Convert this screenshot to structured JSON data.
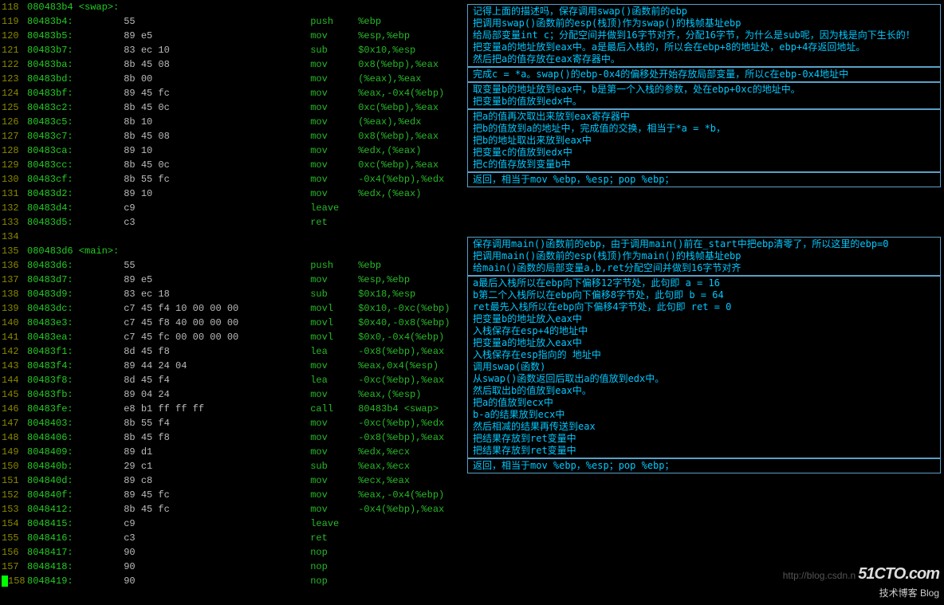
{
  "code_rows": [
    {
      "ln": "118",
      "head": "080483b4 <swap>:"
    },
    {
      "ln": "119",
      "addr": "80483b4:",
      "hex": "55",
      "op": "push",
      "arg": "%ebp"
    },
    {
      "ln": "120",
      "addr": "80483b5:",
      "hex": "89 e5",
      "op": "mov",
      "arg": "%esp,%ebp"
    },
    {
      "ln": "121",
      "addr": "80483b7:",
      "hex": "83 ec 10",
      "op": "sub",
      "arg": "$0x10,%esp"
    },
    {
      "ln": "122",
      "addr": "80483ba:",
      "hex": "8b 45 08",
      "op": "mov",
      "arg": "0x8(%ebp),%eax"
    },
    {
      "ln": "123",
      "addr": "80483bd:",
      "hex": "8b 00",
      "op": "mov",
      "arg": "(%eax),%eax"
    },
    {
      "ln": "124",
      "addr": "80483bf:",
      "hex": "89 45 fc",
      "op": "mov",
      "arg": "%eax,-0x4(%ebp)"
    },
    {
      "ln": "125",
      "addr": "80483c2:",
      "hex": "8b 45 0c",
      "op": "mov",
      "arg": "0xc(%ebp),%eax"
    },
    {
      "ln": "126",
      "addr": "80483c5:",
      "hex": "8b 10",
      "op": "mov",
      "arg": "(%eax),%edx"
    },
    {
      "ln": "127",
      "addr": "80483c7:",
      "hex": "8b 45 08",
      "op": "mov",
      "arg": "0x8(%ebp),%eax"
    },
    {
      "ln": "128",
      "addr": "80483ca:",
      "hex": "89 10",
      "op": "mov",
      "arg": "%edx,(%eax)"
    },
    {
      "ln": "129",
      "addr": "80483cc:",
      "hex": "8b 45 0c",
      "op": "mov",
      "arg": "0xc(%ebp),%eax"
    },
    {
      "ln": "130",
      "addr": "80483cf:",
      "hex": "8b 55 fc",
      "op": "mov",
      "arg": "-0x4(%ebp),%edx"
    },
    {
      "ln": "131",
      "addr": "80483d2:",
      "hex": "89 10",
      "op": "mov",
      "arg": "%edx,(%eax)"
    },
    {
      "ln": "132",
      "addr": "80483d4:",
      "hex": "c9",
      "op": "leave",
      "arg": ""
    },
    {
      "ln": "133",
      "addr": "80483d5:",
      "hex": "c3",
      "op": "ret",
      "arg": ""
    },
    {
      "ln": "134",
      "blank": true
    },
    {
      "ln": "135",
      "head": "080483d6 <main>:"
    },
    {
      "ln": "136",
      "addr": "80483d6:",
      "hex": "55",
      "op": "push",
      "arg": "%ebp"
    },
    {
      "ln": "137",
      "addr": "80483d7:",
      "hex": "89 e5",
      "op": "mov",
      "arg": "%esp,%ebp"
    },
    {
      "ln": "138",
      "addr": "80483d9:",
      "hex": "83 ec 18",
      "op": "sub",
      "arg": "$0x18,%esp"
    },
    {
      "ln": "139",
      "addr": "80483dc:",
      "hex": "c7 45 f4 10 00 00 00",
      "op": "movl",
      "arg": "$0x10,-0xc(%ebp)"
    },
    {
      "ln": "140",
      "addr": "80483e3:",
      "hex": "c7 45 f8 40 00 00 00",
      "op": "movl",
      "arg": "$0x40,-0x8(%ebp)"
    },
    {
      "ln": "141",
      "addr": "80483ea:",
      "hex": "c7 45 fc 00 00 00 00",
      "op": "movl",
      "arg": "$0x0,-0x4(%ebp)"
    },
    {
      "ln": "142",
      "addr": "80483f1:",
      "hex": "8d 45 f8",
      "op": "lea",
      "arg": "-0x8(%ebp),%eax"
    },
    {
      "ln": "143",
      "addr": "80483f4:",
      "hex": "89 44 24 04",
      "op": "mov",
      "arg": "%eax,0x4(%esp)"
    },
    {
      "ln": "144",
      "addr": "80483f8:",
      "hex": "8d 45 f4",
      "op": "lea",
      "arg": "-0xc(%ebp),%eax"
    },
    {
      "ln": "145",
      "addr": "80483fb:",
      "hex": "89 04 24",
      "op": "mov",
      "arg": "%eax,(%esp)"
    },
    {
      "ln": "146",
      "addr": "80483fe:",
      "hex": "e8 b1 ff ff ff",
      "op": "call",
      "arg": "80483b4 <swap>"
    },
    {
      "ln": "147",
      "addr": "8048403:",
      "hex": "8b 55 f4",
      "op": "mov",
      "arg": "-0xc(%ebp),%edx"
    },
    {
      "ln": "148",
      "addr": "8048406:",
      "hex": "8b 45 f8",
      "op": "mov",
      "arg": "-0x8(%ebp),%eax"
    },
    {
      "ln": "149",
      "addr": "8048409:",
      "hex": "89 d1",
      "op": "mov",
      "arg": "%edx,%ecx"
    },
    {
      "ln": "150",
      "addr": "804840b:",
      "hex": "29 c1",
      "op": "sub",
      "arg": "%eax,%ecx"
    },
    {
      "ln": "151",
      "addr": "804840d:",
      "hex": "89 c8",
      "op": "mov",
      "arg": "%ecx,%eax"
    },
    {
      "ln": "152",
      "addr": "804840f:",
      "hex": "89 45 fc",
      "op": "mov",
      "arg": "%eax,-0x4(%ebp)"
    },
    {
      "ln": "153",
      "addr": "8048412:",
      "hex": "8b 45 fc",
      "op": "mov",
      "arg": "-0x4(%ebp),%eax"
    },
    {
      "ln": "154",
      "addr": "8048415:",
      "hex": "c9",
      "op": "leave",
      "arg": ""
    },
    {
      "ln": "155",
      "addr": "8048416:",
      "hex": "c3",
      "op": "ret",
      "arg": ""
    },
    {
      "ln": "156",
      "addr": "8048417:",
      "hex": "90",
      "op": "nop",
      "arg": ""
    },
    {
      "ln": "157",
      "addr": "8048418:",
      "hex": "90",
      "op": "nop",
      "arg": ""
    },
    {
      "ln": "158",
      "addr": "8048419:",
      "hex": "90",
      "op": "nop",
      "arg": "",
      "cursor": true
    }
  ],
  "annot_blocks": [
    {
      "lines": [
        "记得上面的描述吗，保存调用swap()函数前的ebp",
        "把调用swap()函数前的esp(栈顶)作为swap()的栈帧基址ebp",
        "给局部变量int c；分配空间并做到16字节对齐，分配16字节，为什么是sub呢，因为栈是向下生长的！",
        "把变量a的地址放到eax中。a是最后入栈的，所以会在ebp+8的地址处，ebp+4存返回地址。",
        "然后把a的值存放在eax寄存器中。"
      ]
    },
    {
      "lines": [
        "完成c = *a。swap()的ebp-0x4的偏移处开始存放局部变量，所以c在ebp-0x4地址中"
      ]
    },
    {
      "lines": [
        "取变量b的地址放到eax中，b是第一个入栈的参数，处在ebp+0xc的地址中。",
        "把变量b的值放到edx中。"
      ]
    },
    {
      "lines": [
        "把a的值再次取出来放到eax寄存器中",
        "把b的值放到a的地址中，完成值的交换，相当于*a = *b，",
        "把b的地址取出来放到eax中",
        "把变量c的值放到edx中",
        "把c的值存放到变量b中"
      ]
    },
    {
      "lines": [
        "返回，相当于mov   %ebp，%esp；pop  %ebp；"
      ]
    },
    {
      "spacer": "lg"
    },
    {
      "lines": [
        "保存调用main()函数前的ebp，由于调用main()前在_start中把ebp清零了，所以这里的ebp=0",
        "把调用main()函数前的esp(栈顶)作为main()的栈帧基址ebp",
        "给main()函数的局部变量a,b,ret分配空间并做到16字节对齐"
      ]
    },
    {
      "lines": [
        "a最后入栈所以在ebp向下偏移12字节处，此句即 a = 16",
        "b第二个入栈所以在ebp向下偏移8字节处，此句即 b = 64",
        "ret最先入栈所以在ebp向下偏移4字节处，此句即 ret = 0",
        "把变量b的地址放入eax中",
        "入栈保存在esp+4的地址中",
        "把变量a的地址放入eax中",
        "入栈保存在esp指向的  地址中",
        "调用swap(函数)",
        "从swap()函数返回后取出a的值放到edx中。",
        "然后取出b的值放到eax中。",
        "把a的值放到ecx中",
        "b-a的结果放到ecx中",
        "然后相减的结果再传送到eax",
        "把结果存放到ret变量中",
        "把结果存放到ret变量中"
      ]
    },
    {
      "lines": [
        "返回，相当于mov   %ebp，%esp；pop  %ebp；"
      ]
    }
  ],
  "footer": {
    "url": "http://blog.csdn.n",
    "logo": "51CTO.com",
    "sub": "技术博客  Blog"
  }
}
